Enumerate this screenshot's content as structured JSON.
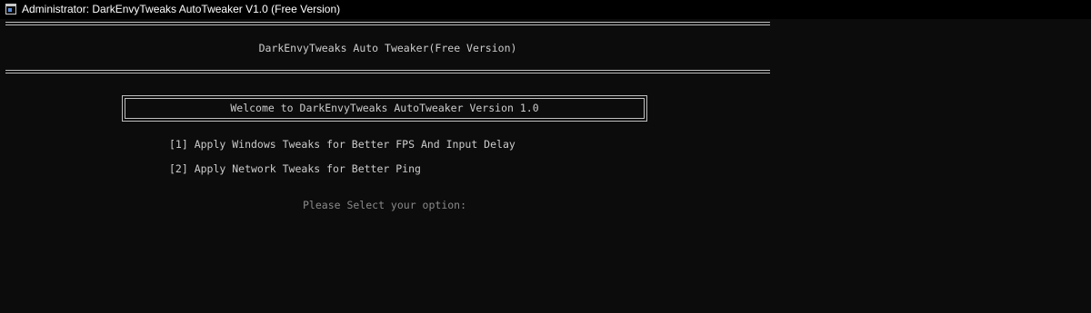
{
  "window": {
    "title": "Administrator:  DarkEnvyTweaks AutoTweaker V1.0 (Free Version)",
    "icon": "console-window-icon"
  },
  "console": {
    "header": "DarkEnvyTweaks Auto Tweaker(Free Version)",
    "welcome": "Welcome to DarkEnvyTweaks AutoTweaker Version 1.0",
    "menu": [
      {
        "label": "[1] Apply Windows Tweaks for Better FPS And Input Delay"
      },
      {
        "label": "[2] Apply Network Tweaks for Better Ping"
      }
    ],
    "prompt": "Please Select your option:"
  },
  "colors": {
    "background": "#0c0c0c",
    "text": "#cccccc",
    "prompt_text": "#8a8a8a",
    "titlebar": "#000000"
  }
}
